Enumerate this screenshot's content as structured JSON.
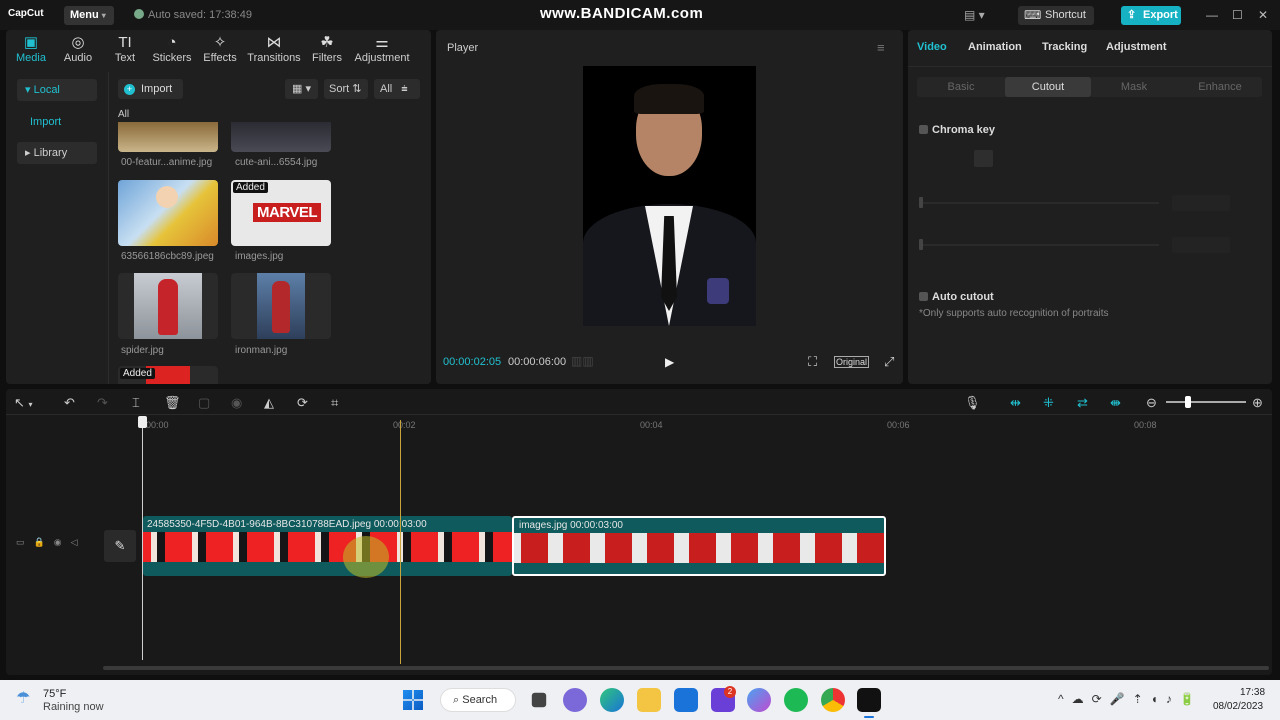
{
  "app": {
    "logo": "CapCut",
    "menu_label": "Menu",
    "autosave": "Auto saved: 17:38:49",
    "watermark": "www.BANDICAM.com",
    "shortcut_label": "Shortcut",
    "export_label": "Export"
  },
  "media_tabs": [
    "Media",
    "Audio",
    "Text",
    "Stickers",
    "Effects",
    "Transitions",
    "Filters",
    "Adjustment"
  ],
  "media_tab_icons": [
    "▣",
    "◎",
    "TI",
    "◔",
    "✧",
    "⋈",
    "☘",
    "⚌"
  ],
  "sidebar": {
    "local": "Local",
    "import": "Import",
    "library": "Library"
  },
  "toolbar": {
    "import_label": "Import",
    "sort_label": "Sort",
    "all_label": "All",
    "section_label": "All"
  },
  "media_items": [
    {
      "name": "00-featur...anime.jpg",
      "added": ""
    },
    {
      "name": "cute-ani...6554.jpg",
      "added": ""
    },
    {
      "name": "63566186cbc89.jpeg",
      "added": ""
    },
    {
      "name": "images.jpg",
      "added": "Added"
    },
    {
      "name": "spider.jpg",
      "added": ""
    },
    {
      "name": "ironman.jpg",
      "added": ""
    },
    {
      "name": "",
      "added": "Added"
    }
  ],
  "player": {
    "title": "Player",
    "current_time": "00:00:02:05",
    "total_time": "00:00:06:00",
    "original_label": "Original"
  },
  "right_panel": {
    "tabs": [
      "Video",
      "Animation",
      "Tracking",
      "Adjustment"
    ],
    "subtabs": [
      "Basic",
      "Cutout",
      "Mask",
      "Enhance"
    ],
    "chroma_key": "Chroma key",
    "auto_cutout": "Auto cutout",
    "auto_cutout_note": "*Only supports auto recognition of portraits"
  },
  "timeline": {
    "ruler": [
      "00:00",
      "00:02",
      "00:04",
      "00:06",
      "00:08"
    ],
    "clip1": {
      "name": "24585350-4F5D-4B01-964B-8BC310788EAD.jpeg",
      "duration": "00:00:03:00"
    },
    "clip2": {
      "name": "images.jpg",
      "duration": "00:00:03:00"
    },
    "marvel_text": "MARVEL"
  },
  "taskbar": {
    "temp": "75°F",
    "weather": "Raining now",
    "search_label": "Search",
    "time": "17:38",
    "date": "08/02/2023",
    "badge": "2"
  },
  "colors": {
    "accent": "#21c0d0",
    "export": "#16b2c4",
    "clip1_bg": "#0f5a5c",
    "clip2_border": "#ffffff",
    "playhead": "#c8a43a"
  }
}
